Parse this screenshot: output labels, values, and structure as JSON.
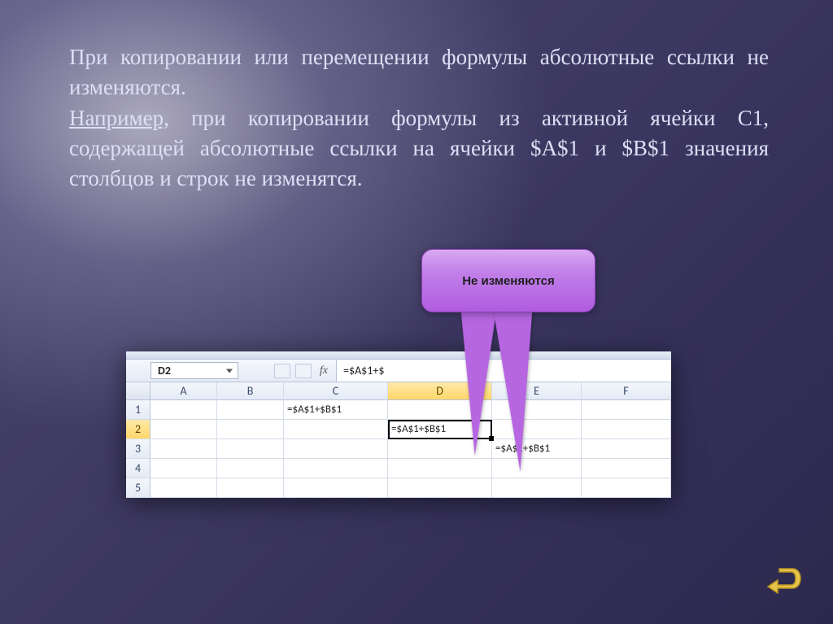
{
  "paragraph": {
    "line1": "При копировании или перемещении формулы абсолютные ссылки не изменяются.",
    "line2_prefix": " Например,",
    "line2_rest": " при копировании формулы из активной ячейки С1, содержащей абсолютные ссылки на ячейки $A$1 и $B$1 значения столбцов и строк не изменятся."
  },
  "callout": {
    "text": "Не изменяются"
  },
  "excel": {
    "name_box": "D2",
    "fx_label": "fx",
    "formula_bar": "=$A$1+$",
    "columns": [
      "A",
      "B",
      "C",
      "D",
      "E",
      "F"
    ],
    "rows": [
      "1",
      "2",
      "3",
      "4",
      "5"
    ],
    "cells": {
      "C1": "=$A$1+$B$1",
      "D2": "=$A$1+$B$1",
      "E3": "=$A$1+$B$1"
    },
    "active_cell": "D2",
    "selected_col": "D",
    "selected_row": "2"
  },
  "nav": {
    "back_title": "back"
  }
}
